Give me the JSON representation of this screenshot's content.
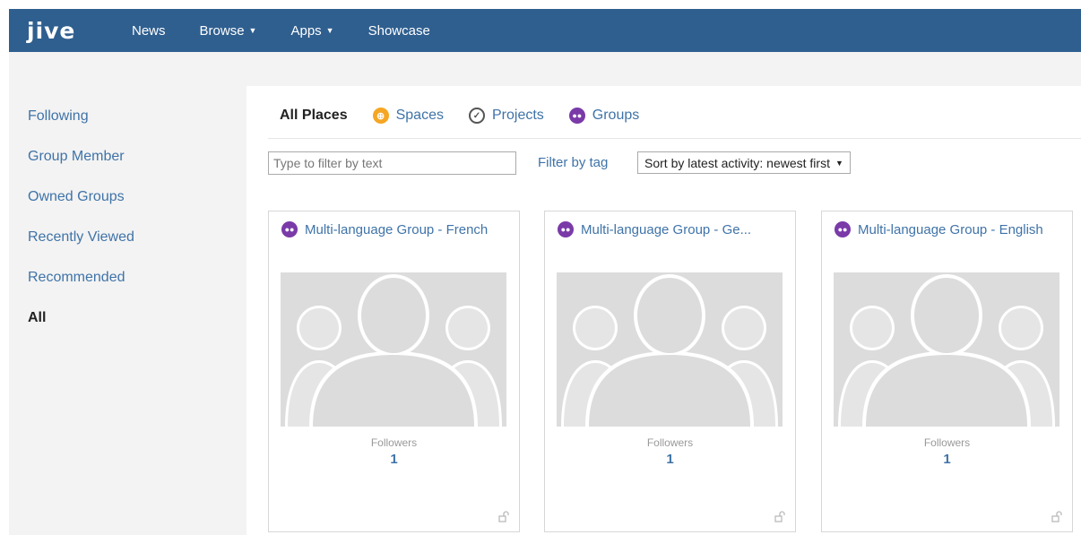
{
  "navbar": {
    "logo": "jive",
    "items": [
      {
        "label": "News",
        "has_menu": false
      },
      {
        "label": "Browse",
        "has_menu": true
      },
      {
        "label": "Apps",
        "has_menu": true
      },
      {
        "label": "Showcase",
        "has_menu": false
      }
    ],
    "background_color": "#2f5f8f"
  },
  "sidebar": {
    "items": [
      {
        "label": "Following"
      },
      {
        "label": "Group Member"
      },
      {
        "label": "Owned Groups"
      },
      {
        "label": "Recently Viewed"
      },
      {
        "label": "Recommended"
      },
      {
        "label": "All",
        "active": true
      }
    ]
  },
  "tabs": {
    "items": [
      {
        "label": "All Places",
        "active": true,
        "icon": null
      },
      {
        "label": "Spaces",
        "icon": "spaces-icon"
      },
      {
        "label": "Projects",
        "icon": "projects-icon"
      },
      {
        "label": "Groups",
        "icon": "groups-icon"
      }
    ]
  },
  "filters": {
    "text_placeholder": "Type to filter by text",
    "text_value": "",
    "tag_link": "Filter by tag",
    "sort_selected": "Sort by latest activity: newest first"
  },
  "cards": [
    {
      "title": "Multi-language Group - French",
      "followers_label": "Followers",
      "followers_count": "1"
    },
    {
      "title": "Multi-language Group - Ge...",
      "followers_label": "Followers",
      "followers_count": "1"
    },
    {
      "title": "Multi-language Group - English",
      "followers_label": "Followers",
      "followers_count": "1"
    }
  ],
  "colors": {
    "link": "#3f73a8",
    "group_icon": "#7a3aa8",
    "space_icon": "#f5a623"
  }
}
